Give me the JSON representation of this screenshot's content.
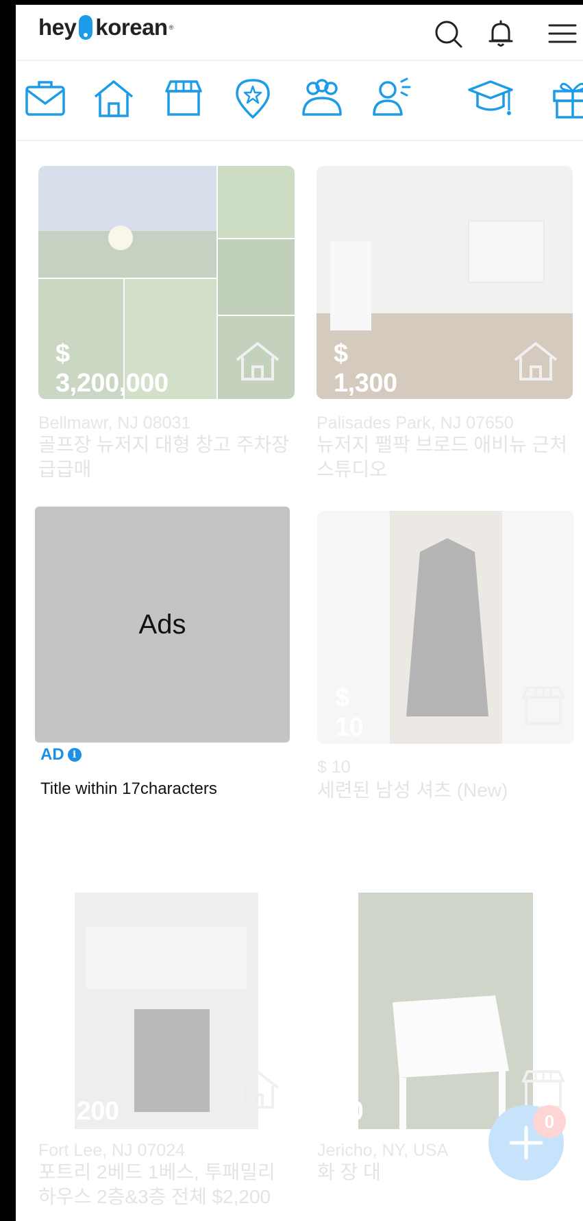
{
  "header": {
    "logo_left": "hey",
    "logo_right": "korean",
    "logo_reg": "®",
    "icons": [
      "search-icon",
      "bell-icon",
      "menu-icon"
    ]
  },
  "categories": [
    {
      "name": "jobs-icon"
    },
    {
      "name": "realestate-icon"
    },
    {
      "name": "market-icon"
    },
    {
      "name": "local-icon"
    },
    {
      "name": "community-icon"
    },
    {
      "name": "announce-icon"
    },
    {
      "name": "education-icon"
    },
    {
      "name": "gift-icon"
    }
  ],
  "listings": [
    {
      "price": "$ 3,200,000",
      "location": "Bellmawr, NJ 08031",
      "title": "골프장 뉴저지 대형 창고 주차장 급급매",
      "category_icon": "house-icon"
    },
    {
      "price": "$ 1,300",
      "location": "Palisades Park, NJ 07650",
      "title": "뉴저지 팰팍 브로드 애비뉴 근처 스튜디오",
      "category_icon": "house-icon"
    },
    {
      "price": "$ 10",
      "location": "$ 10",
      "title": "세련된 남성 셔츠 (New)",
      "category_icon": "store-icon"
    },
    {
      "price": "$ 2,200",
      "location": "Fort Lee, NJ 07024",
      "title": "포트리 2베드 1베스, 투패밀리 하우스 2층&3층 전체 $2,200",
      "category_icon": "house-icon"
    },
    {
      "price": "$ 60",
      "location": "Jericho, NY, USA",
      "title": "화 장 대",
      "category_icon": "store-icon"
    }
  ],
  "ad": {
    "box_label": "Ads",
    "tag": "AD",
    "info_glyph": "i",
    "title": "Title within 17characters"
  },
  "fab": {
    "badge_count": "0",
    "icon": "plus-icon"
  },
  "colors": {
    "brand_blue": "#1c9ce8",
    "ad_gray": "#c4c4c4"
  }
}
